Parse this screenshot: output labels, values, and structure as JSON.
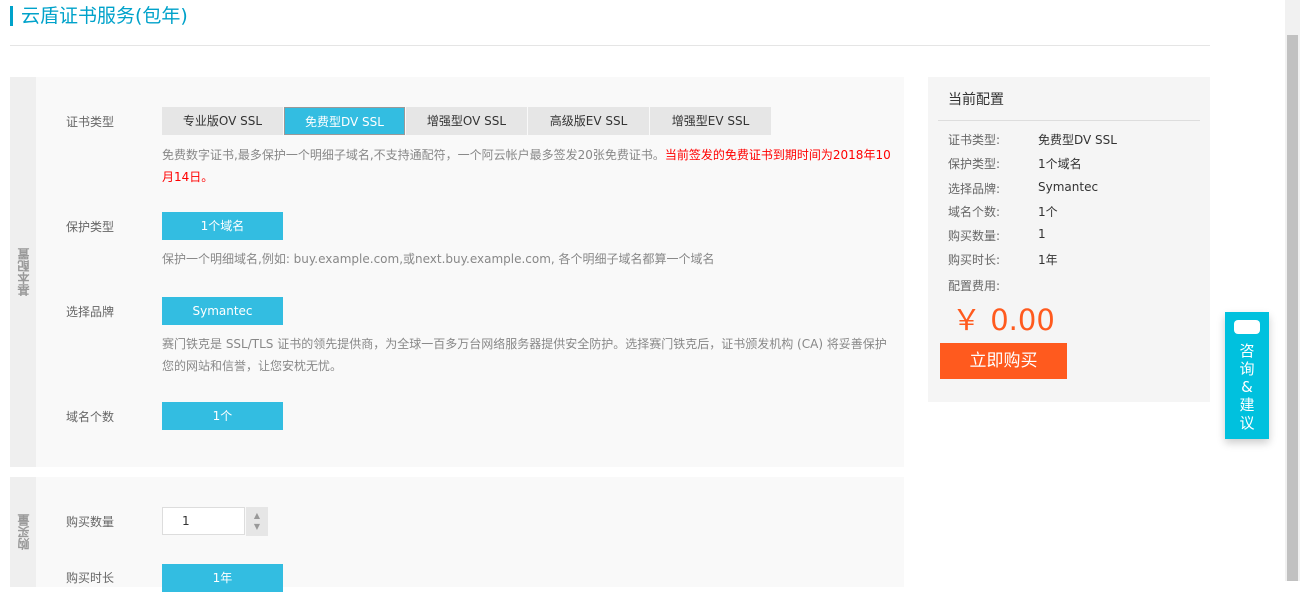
{
  "title": "云盾证书服务(包年)",
  "basic": {
    "side_label": "基本配置",
    "cert_type": {
      "label": "证书类型",
      "options": [
        "专业版OV SSL",
        "免费型DV SSL",
        "增强型OV SSL",
        "高级版EV SSL",
        "增强型EV SSL"
      ],
      "selected": "免费型DV SSL",
      "desc": "免费数字证书,最多保护一个明细子域名,不支持通配符，一个阿云帐户最多签发20张免费证书。",
      "desc_red": "当前签发的免费证书到期时间为2018年10月14日。"
    },
    "protect": {
      "label": "保护类型",
      "value": "1个域名",
      "desc": "保护一个明细域名,例如: buy.example.com,或next.buy.example.com, 各个明细子域名都算一个域名"
    },
    "brand": {
      "label": "选择品牌",
      "value": "Symantec",
      "desc": "赛门铁克是 SSL/TLS 证书的领先提供商，为全球一百多万台网络服务器提供安全防护。选择赛门铁克后，证书颁发机构 (CA) 将妥善保护您的网站和信誉，让您安枕无忧。"
    },
    "domains": {
      "label": "域名个数",
      "value": "1个"
    }
  },
  "purchase": {
    "side_label": "购买量",
    "qty_label": "购买数量",
    "qty": "1",
    "duration_label": "购买时长",
    "duration": "1年"
  },
  "config": {
    "title": "当前配置",
    "rows": [
      {
        "k": "证书类型:",
        "v": "免费型DV SSL"
      },
      {
        "k": "保护类型:",
        "v": "1个域名"
      },
      {
        "k": "选择品牌:",
        "v": "Symantec"
      },
      {
        "k": "域名个数:",
        "v": "1个"
      },
      {
        "k": "购买数量:",
        "v": "1"
      },
      {
        "k": "购买时长:",
        "v": "1年"
      }
    ],
    "fee_label": "配置费用:",
    "price": "￥ 0.00",
    "buy": "立即购买"
  },
  "float": {
    "icon": "chat-icon",
    "c1": "咨",
    "c2": "询",
    "c3": "&",
    "c4": "建",
    "c5": "议"
  },
  "colors": {
    "accent": "#33bde1",
    "orange": "#ff5a1e"
  }
}
